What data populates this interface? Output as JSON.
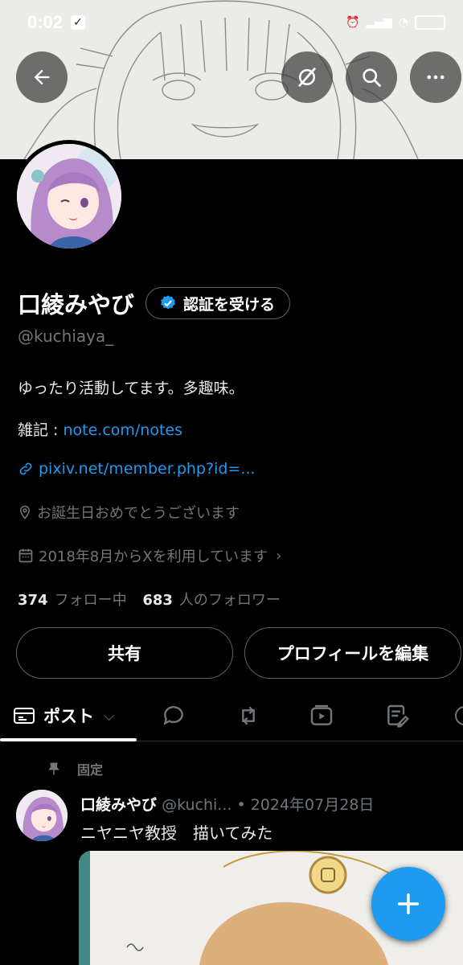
{
  "status_bar": {
    "time": "0:02",
    "battery": ""
  },
  "profile": {
    "name": "口綾みやび",
    "verify_label": "認証を受ける",
    "handle": "@kuchiaya_",
    "bio": "ゆったり活動してます。多趣味。",
    "note_prefix": "雑記 : ",
    "note_link": "note.com/notes",
    "website": "pixiv.net/member.php?id=...",
    "location": "お誕生日おめでとうございます",
    "joined": "2018年8月からXを利用しています",
    "following_count": "374",
    "following_label": "フォロー中",
    "followers_count": "683",
    "followers_label": "人のフォロワー"
  },
  "buttons": {
    "share": "共有",
    "edit_profile": "プロフィールを編集"
  },
  "tabs": [
    {
      "label": "ポスト",
      "icon": "posts-icon"
    },
    {
      "label": "",
      "icon": "replies-icon"
    },
    {
      "label": "",
      "icon": "repost-icon"
    },
    {
      "label": "",
      "icon": "media-icon"
    },
    {
      "label": "",
      "icon": "articles-icon"
    }
  ],
  "post": {
    "pinned_label": "固定",
    "author": "口綾みやび",
    "handle_date": "@kuchi... • 2024年07月28日",
    "text": "ニヤニヤ教授　描いてみた"
  },
  "colors": {
    "accent": "#1d9bf0",
    "background": "#000000",
    "muted": "#71767b"
  }
}
